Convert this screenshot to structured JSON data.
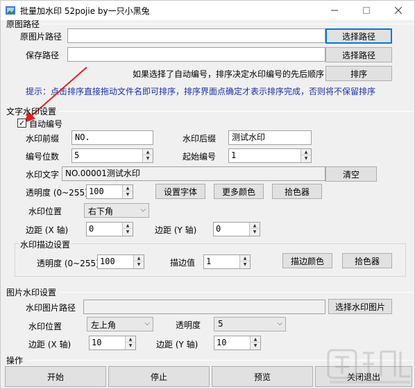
{
  "window": {
    "title": "批量加水印 52pojie by一只小黑兔",
    "minimize_icon": "minimize-icon",
    "maximize_icon": "maximize-icon",
    "close_icon": "close-icon"
  },
  "source": {
    "section_title": "原图路径",
    "src_label": "原图片路径",
    "src_value": "",
    "src_button": "选择路径",
    "save_label": "保存路径",
    "save_value": "",
    "save_button": "选择路径",
    "sort_note": "如果选择了自动编号，排序决定水印编号的先后顺序",
    "sort_button": "排序",
    "tip": "提示：点击排序直接拖动文件名即可排序，排序界面点确定才表示排序完成，否则将不保留排序"
  },
  "text_watermark": {
    "section_title": "文字水印设置",
    "auto_number_label": "自动编号",
    "auto_number_checked": true,
    "prefix_label": "水印前缀",
    "prefix_value": "NO.",
    "suffix_label": "水印后缀",
    "suffix_value": "测试水印",
    "digits_label": "编号位数",
    "digits_value": "5",
    "start_label": "起始编号",
    "start_value": "1",
    "text_label": "水印文字",
    "text_value": "NO.00001测试水印",
    "clear_button": "清空",
    "opacity_label": "透明度 (0~255)",
    "opacity_value": "100",
    "font_button": "设置字体",
    "more_colors_button": "更多颜色",
    "picker_button": "拾色器",
    "position_label": "水印位置",
    "position_value": "右下角",
    "margin_x_label": "边距 (X 轴)",
    "margin_x_value": "0",
    "margin_y_label": "边距 (Y 轴)",
    "margin_y_value": "0"
  },
  "stroke": {
    "section_title": "水印描边设置",
    "opacity_label": "透明度 (0~255)",
    "opacity_value": "100",
    "stroke_label": "描边值",
    "stroke_value": "1",
    "color_button": "描边颜色",
    "picker_button": "拾色器"
  },
  "image_watermark": {
    "section_title": "图片水印设置",
    "path_label": "水印图片路径",
    "path_value": "",
    "select_button": "选择水印图片",
    "position_label": "水印位置",
    "position_value": "左上角",
    "opacity_label": "透明度",
    "opacity_value": "5",
    "margin_x_label": "边距 (X 轴)",
    "margin_x_value": "10",
    "margin_y_label": "边距 (Y 轴)",
    "margin_y_value": "10"
  },
  "operations": {
    "section_title": "操作",
    "start_button": "开始",
    "stop_button": "停止",
    "preview_button": "预览",
    "exit_button": "关闭退出"
  },
  "colors": {
    "tip_text": "#1a2fa8",
    "arrow": "#e02020",
    "focus_border": "#0078d7"
  }
}
